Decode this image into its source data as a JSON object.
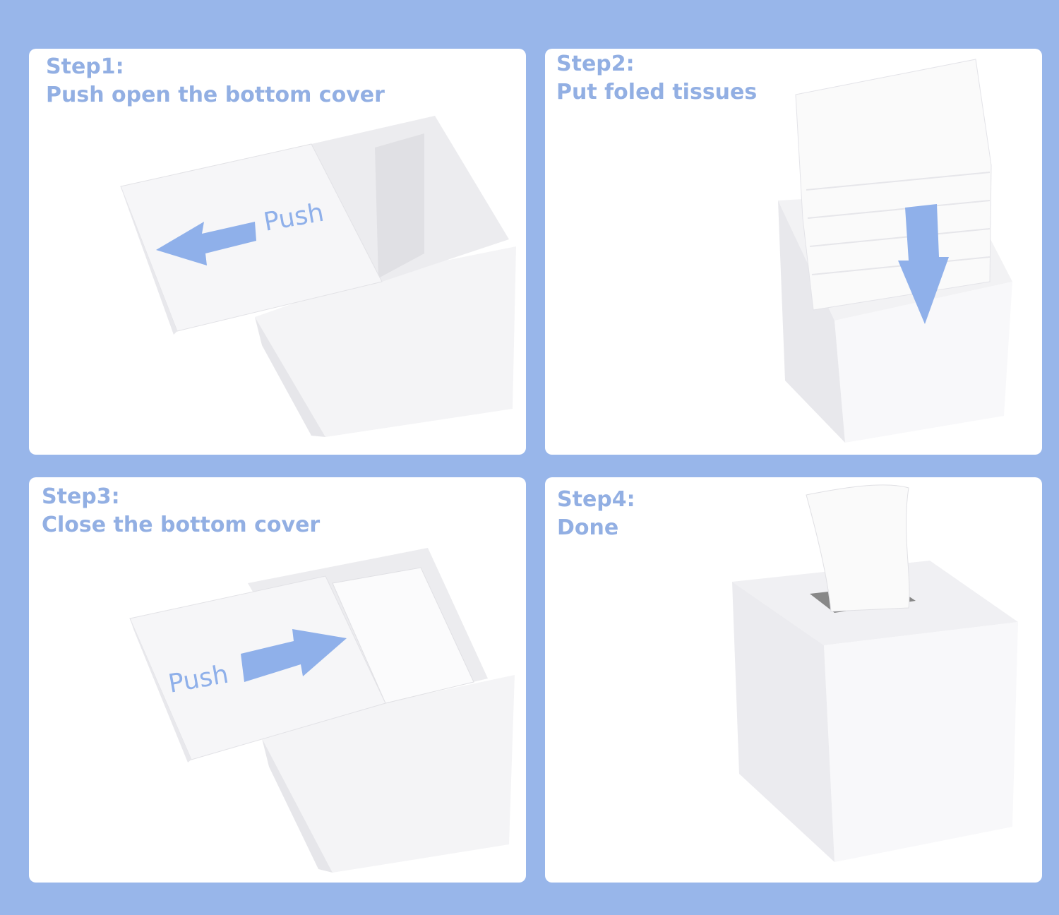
{
  "steps": [
    {
      "label": "Step1:",
      "text": "Push open the bottom cover",
      "arrow_label": "Push"
    },
    {
      "label": "Step2:",
      "text": "Put foled tissues"
    },
    {
      "label": "Step3:",
      "text": "Close the bottom cover",
      "arrow_label": "Push"
    },
    {
      "label": "Step4:",
      "text": "Done"
    }
  ],
  "colors": {
    "background": "#98b6ea",
    "text": "#92afe3",
    "arrow": "#8fb0ea"
  }
}
